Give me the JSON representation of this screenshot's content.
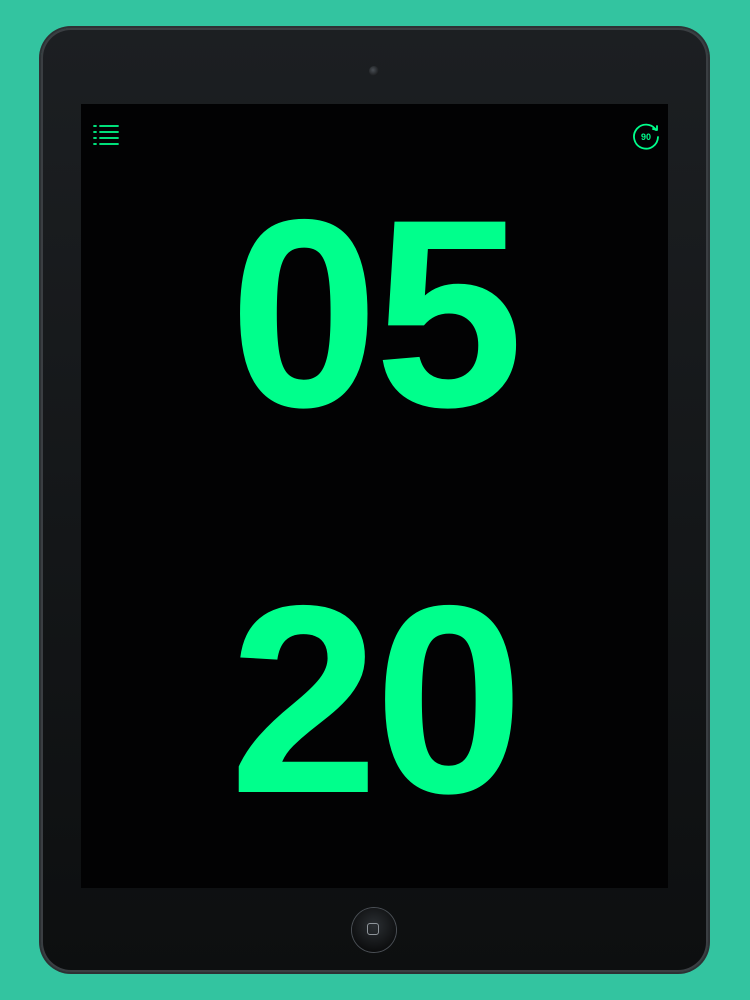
{
  "timer": {
    "minutes": "05",
    "seconds": "20",
    "preset_badge": "90"
  },
  "icons": {
    "menu": "list-menu-icon",
    "timer": "timer-90-icon",
    "home": "home-button-icon"
  },
  "colors": {
    "background": "#33c4a0",
    "screen": "#020203",
    "accent": "#00ff8c"
  }
}
